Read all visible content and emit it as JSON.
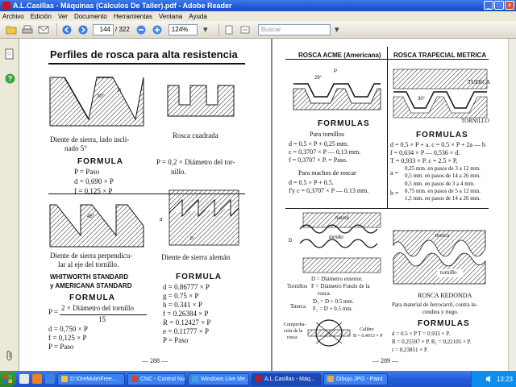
{
  "window": {
    "title": "A.L.Casillas - Máquinas (Cálculos De Taller).pdf - Adobe Reader",
    "minimize": "_",
    "maximize": "□",
    "close": "×"
  },
  "menu": [
    "Archivo",
    "Edición",
    "Ver",
    "Documento",
    "Herramientas",
    "Ventana",
    "Ayuda"
  ],
  "toolbar": {
    "page_current": "144",
    "page_total": "/ 322",
    "zoom": "124%",
    "search_placeholder": "Buscar"
  },
  "left_page": {
    "title": "Perfiles de rosca para alta resistencia",
    "fig1_caption": [
      "Diente de sierra, lado incli-",
      "nado 5°"
    ],
    "fig1_formula_head": "FORMULA",
    "fig1_formula": [
      "P = Paso",
      "d = 0,690 × P",
      "f = 0,125 × P"
    ],
    "fig2_caption": "Rosca cuadrada",
    "fig2_formula": [
      "P = 0,2 × Diámetro del tor-",
      "nillo."
    ],
    "fig3_caption": [
      "Diente de sierra perpendicu-",
      "lar al eje del tornillo."
    ],
    "fig3_standard": [
      "WHITWORTH STANDARD",
      "y AMERICANA STANDARD"
    ],
    "fig3_formula_head": "FORMULA",
    "fig3_formula_num": "2 × Diámetro del tornillo",
    "fig3_formula_prefix": "P =",
    "fig3_formula_den": "15",
    "fig3_formula": [
      "d = 0,750 × P",
      "f = 0,125 × P",
      "P = Paso"
    ],
    "fig4_caption": "Diente de sierra alemán",
    "fig4_formula_head": "FORMULA",
    "fig4_formula": [
      "d = 0.86777 × P",
      "g = 0.75    × P",
      "h = 0.341   × P",
      "f = 0.26384 × P",
      "R = 0.12427 × P",
      "e = 0.11777 × P",
      "P = Paso"
    ],
    "page_number": "— 288 —"
  },
  "right_page": {
    "acme_head": "ROSCA ACME (Americana)",
    "trap_head": "ROSCA TRAPECIAL METRICA",
    "acme_formulas_head": "FORMULAS",
    "acme_tornillos_label": "Para tornillos",
    "acme_tornillos": [
      "d = 0.5 × P + 0,25 mm.",
      "c = 0,3707 × P — 0,13 mm.",
      "f = 0,3707 × P. = Paso."
    ],
    "acme_machos_label": "Para machos de roscar",
    "acme_machos": [
      "d = 0.5 × P + 0.5.",
      "f'y c = 0,3707 × P — 0.13 mm."
    ],
    "trap_labels": [
      "TUERCA",
      "TORNILLO"
    ],
    "trap_formulas_head": "FORMULAS",
    "trap_formulas": [
      "d = 0.5 × P + a. c = 0.5 × P + 2a — b",
      "f = 0,634 × P — 0,536 × d.",
      "T = 0,933 × P.   c = 2.5 × P."
    ],
    "trap_a_label": "a =",
    "trap_a_rows": [
      "0,25 mm. en pasos de  3 a 12 mm.",
      "0,5 mm. en pasos de 14 a 26 mm."
    ],
    "trap_b_label": "b =",
    "trap_b_rows": [
      "0,5 mm. en pasos de  3 a  4 mm.",
      "0,75 mm. en pasos de  5 a 12 mm.",
      "1,5 mm. en pasos de 14 a 26 mm."
    ],
    "acme_fig2_labels": [
      "tuerca",
      "tornillo"
    ],
    "acme_fig2_text": [
      "D = Diámetro exterior.",
      "F = Diámetro Fondo de la",
      "rosca.",
      "D₁ = D + 0.5 mm.",
      "F₁ = D + 0.5 mm."
    ],
    "acme_fig2_tornillo": "Tornillos",
    "acme_fig2_tuerca": "Tuerca",
    "acme_fig2_bottom": [
      "Comproba-",
      "ción de la",
      "rosca"
    ],
    "acme_fig2_calibre": [
      "Calibre",
      "B = 0.4913 × P"
    ],
    "round_labels": [
      "tuerca",
      "tornillo"
    ],
    "round_head": "ROSCA REDONDA",
    "round_desc": [
      "Para material de ferrocarril, contra in-",
      "cendios y riego."
    ],
    "round_formulas_head": "FORMULAS",
    "round_formulas": [
      "d = 0.5 × P      T = 0.933 × P.",
      "R = 0,25597 × P.    R₁ = 0,22105 × P.",
      "r = 0,23851 × P."
    ],
    "page_number": "— 289 —"
  },
  "taskbar": {
    "tasks": [
      {
        "label": "D:\\DreMule\\Free...",
        "color": "#f0c040"
      },
      {
        "label": "CNC - Control Nu...",
        "color": "#e04020"
      },
      {
        "label": "Windows Live Me...",
        "color": "#40a0e0"
      },
      {
        "label": "A.L.Casillas - Máq...",
        "color": "#c8141e"
      },
      {
        "label": "Dibujo.JPG - Paint",
        "color": "#e0b040"
      }
    ],
    "clock": "13:23"
  }
}
